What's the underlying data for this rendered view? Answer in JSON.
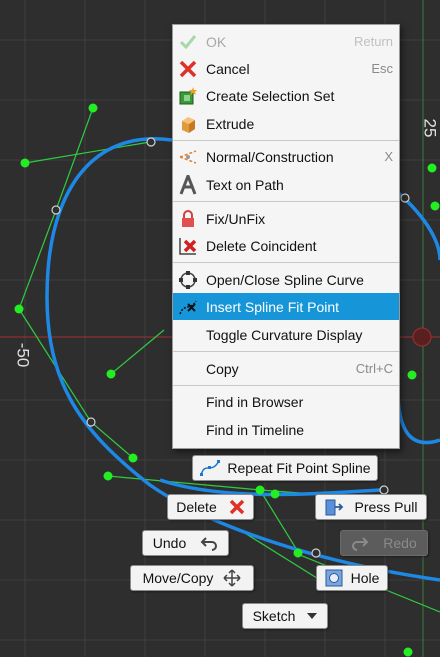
{
  "context_menu": {
    "items": [
      {
        "label": "OK",
        "shortcut": "Return",
        "icon": "check-icon",
        "disabled": true
      },
      {
        "label": "Cancel",
        "shortcut": "Esc",
        "icon": "close-x-icon"
      },
      {
        "label": "Create Selection Set",
        "shortcut": "",
        "icon": "selection-set-icon"
      },
      {
        "label": "Extrude",
        "shortcut": "",
        "icon": "extrude-icon"
      },
      {
        "label": "Normal/Construction",
        "shortcut": "X",
        "icon": "construction-icon"
      },
      {
        "label": "Text on Path",
        "shortcut": "",
        "icon": "text-icon"
      },
      {
        "label": "Fix/UnFix",
        "shortcut": "",
        "icon": "lock-icon"
      },
      {
        "label": "Delete Coincident",
        "shortcut": "",
        "icon": "delete-coincident-icon"
      },
      {
        "label": "Open/Close Spline Curve",
        "shortcut": "",
        "icon": "spline-curve-icon"
      },
      {
        "label": "Insert Spline Fit Point",
        "shortcut": "",
        "icon": "spline-fit-point-icon",
        "highlighted": true
      },
      {
        "label": "Toggle Curvature Display",
        "shortcut": ""
      },
      {
        "label": "Copy",
        "shortcut": "Ctrl+C"
      },
      {
        "label": "Find in Browser",
        "shortcut": ""
      },
      {
        "label": "Find in Timeline",
        "shortcut": ""
      }
    ]
  },
  "marking_menu": {
    "repeat": "Repeat Fit Point Spline",
    "delete": "Delete",
    "press_pull": "Press Pull",
    "undo": "Undo",
    "redo": "Redo",
    "move_copy": "Move/Copy",
    "hole": "Hole",
    "sketch": "Sketch"
  },
  "axis_labels": {
    "top": "25",
    "left": "-50"
  },
  "colors": {
    "highlight": "#1696d8",
    "spline": "#1e88e5",
    "handle": "#22cc22",
    "background": "#2e2e2e"
  }
}
